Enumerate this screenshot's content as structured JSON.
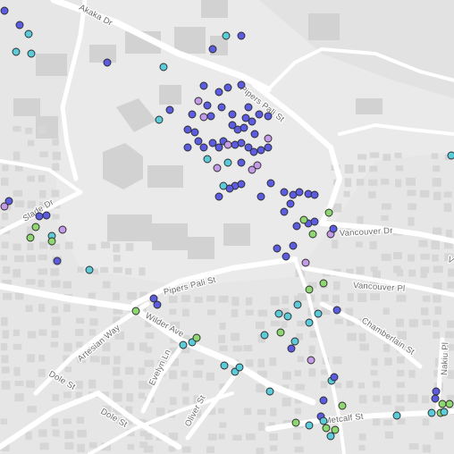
{
  "map": {
    "basemap": "light-gray",
    "colors": {
      "background": "#e6e6e6",
      "road": "#ffffff",
      "building": "#cfcfcf",
      "park": "#dcdcdc",
      "label": "#6b6b6b"
    },
    "marker_categories": [
      {
        "key": "blue",
        "color": "#5c5ce0"
      },
      {
        "key": "teal",
        "color": "#5bcbd9"
      },
      {
        "key": "green",
        "color": "#8ed66f"
      },
      {
        "key": "lavender",
        "color": "#c39be6"
      }
    ],
    "street_labels": {
      "akaka_dr": "Akaka Dr",
      "pipers_pali_st_north": "Pipers Pali St",
      "pipers_pali_st_south": "Pipers Pali St",
      "slade_dr": "Slade Dr",
      "vancouver_dr": "Vancouver Dr",
      "vancouver_pl": "Vancouver Pl",
      "wilder_ave": "Wilder Ave",
      "artesian_way": "Artesian Way",
      "evelyn_ln": "Evelyn Ln",
      "dole_st": "Dole St",
      "dole_st_2": "Dole St",
      "oliver_st": "Oliver St",
      "chamberlain_st": "Chamberlain St",
      "nakiu_pl": "Nakiu Pl",
      "metcalf_st": "Metcalf St",
      "partial_v": "V"
    }
  }
}
